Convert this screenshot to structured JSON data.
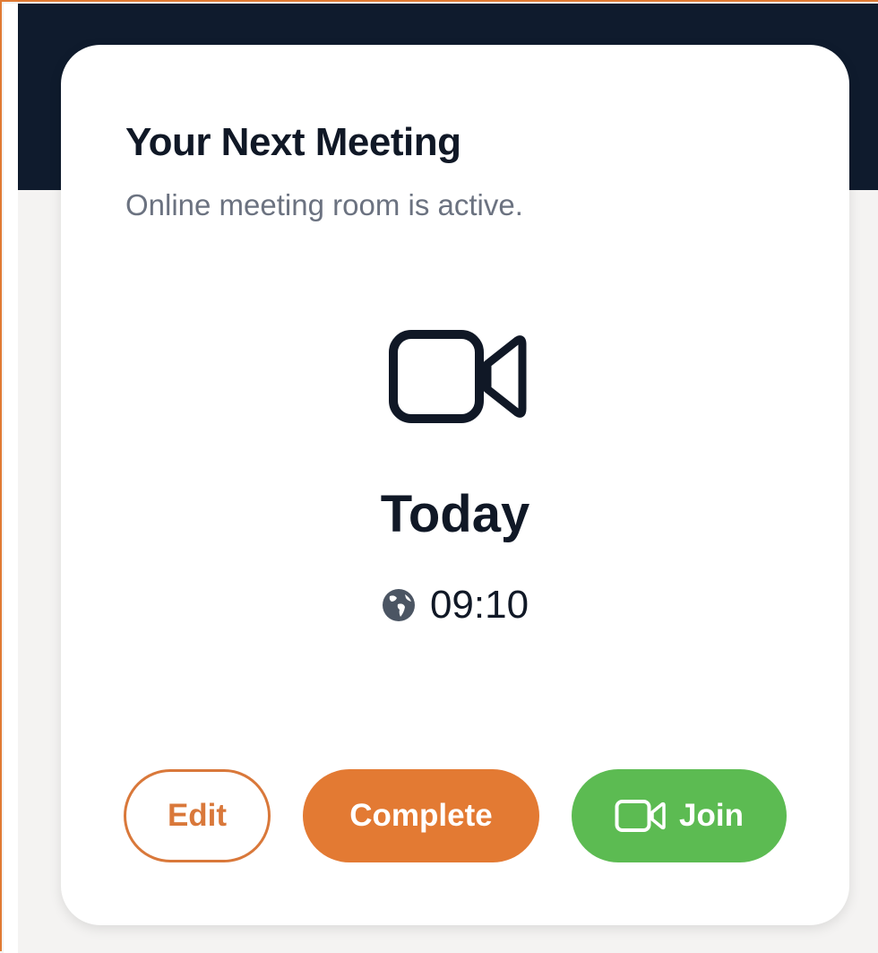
{
  "meeting_card": {
    "title": "Your Next Meeting",
    "subtitle": "Online meeting room is active.",
    "main_icon": "video-camera-icon",
    "day": "Today",
    "time_icon": "globe-icon",
    "time": "09:10"
  },
  "actions": {
    "edit_label": "Edit",
    "complete_label": "Complete",
    "join_label": "Join",
    "join_icon": "video-camera-icon"
  },
  "colors": {
    "header_band": "#0f1b2d",
    "accent_orange": "#e37a33",
    "join_green": "#5cbb52",
    "text_dark": "#101826",
    "text_muted": "#6b7280",
    "page_background": "#f4f3f2"
  }
}
